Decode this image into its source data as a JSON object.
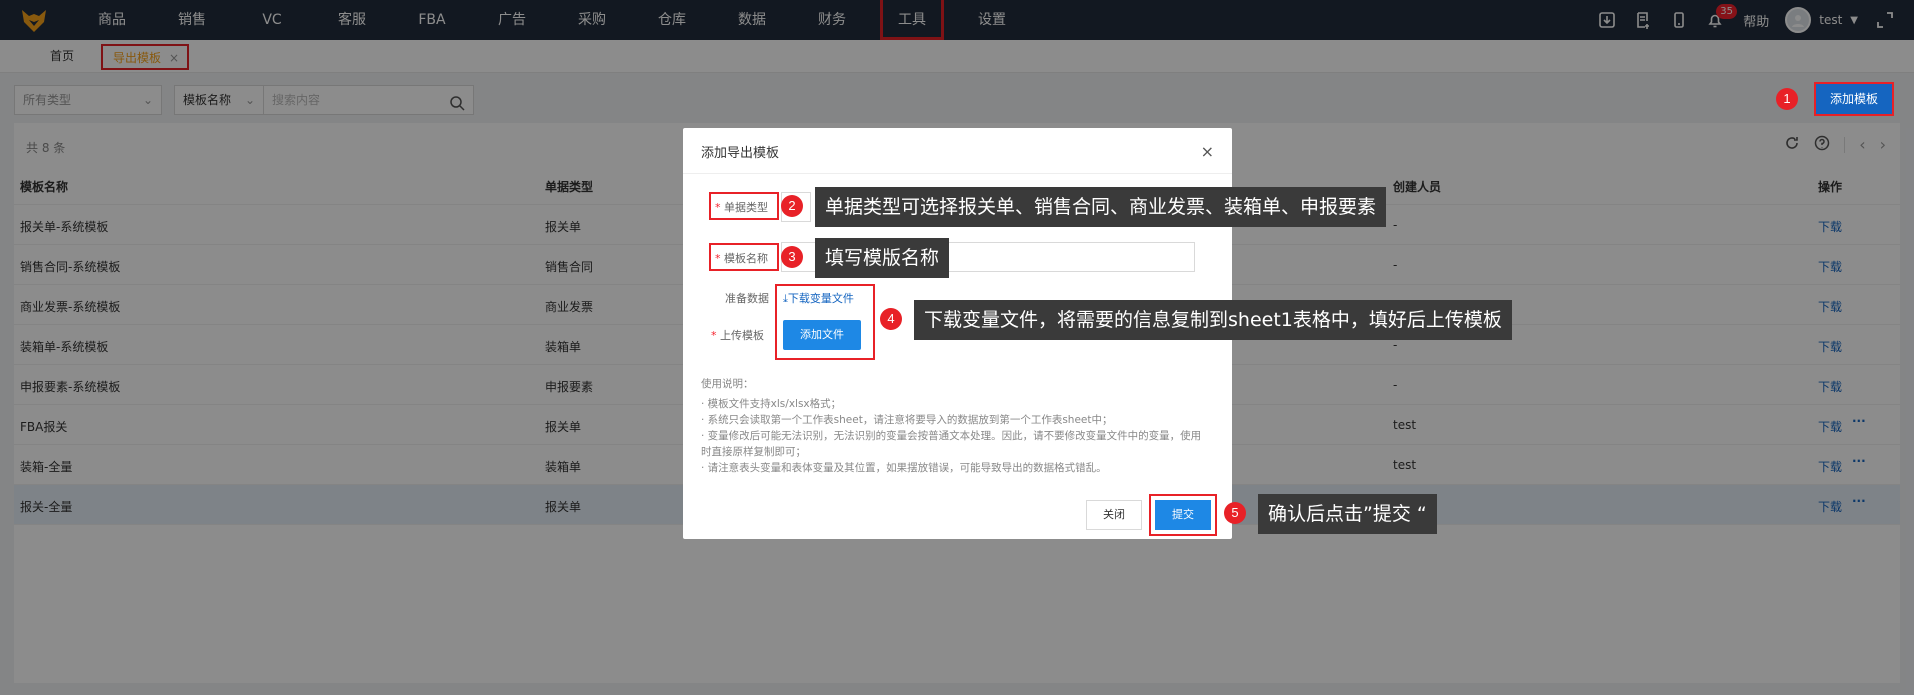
{
  "nav": {
    "items": [
      "商品",
      "销售",
      "VC",
      "客服",
      "FBA",
      "广告",
      "采购",
      "仓库",
      "数据",
      "财务",
      "工具",
      "设置"
    ],
    "active_index": 10
  },
  "top_right": {
    "notification_count": "35",
    "help": "帮助",
    "user": "test"
  },
  "tabs": {
    "home": "首页",
    "current": "导出模板",
    "close": "×"
  },
  "filters": {
    "type_placeholder": "所有类型",
    "field_select": "模板名称",
    "search_placeholder": "搜索内容"
  },
  "add_button": "添加模板",
  "table": {
    "count": "共 8 条",
    "headers": [
      "模板名称",
      "单据类型",
      "创建人员",
      "操作"
    ],
    "rows": [
      {
        "name": "报关单-系统模板",
        "type": "报关单",
        "creator": "-",
        "action": "下载",
        "more": ""
      },
      {
        "name": "销售合同-系统模板",
        "type": "销售合同",
        "creator": "-",
        "action": "下载",
        "more": ""
      },
      {
        "name": "商业发票-系统模板",
        "type": "商业发票",
        "creator": "-",
        "action": "下载",
        "more": ""
      },
      {
        "name": "装箱单-系统模板",
        "type": "装箱单",
        "creator": "-",
        "action": "下载",
        "more": ""
      },
      {
        "name": "申报要素-系统模板",
        "type": "申报要素",
        "creator": "-",
        "action": "下载",
        "more": ""
      },
      {
        "name": "FBA报关",
        "type": "报关单",
        "creator": "test",
        "action": "下载",
        "more": "···"
      },
      {
        "name": "装箱-全量",
        "type": "装箱单",
        "creator": "test",
        "action": "下载",
        "more": "···"
      },
      {
        "name": "报关-全量",
        "type": "报关单",
        "creator": "",
        "action": "下载",
        "more": "···"
      }
    ]
  },
  "dialog": {
    "title": "添加导出模板",
    "close": "×",
    "doc_type_label": "单据类型",
    "template_name_label": "模板名称",
    "prepare_label": "准备数据",
    "download_link": "下载变量文件",
    "upload_label": "上传模板",
    "upload_button": "添加文件",
    "notes_title": "使用说明：",
    "notes": [
      "· 模板文件支持xls/xlsx格式；",
      "· 系统只会读取第一个工作表sheet，请注意将要导入的数据放到第一个工作表sheet中；",
      "· 变量修改后可能无法识别，无法识别的变量会按普通文本处理。因此，请不要修改变量文件中的变量，使用时直接原样复制即可；",
      "· 请注意表头变量和表体变量及其位置，如果摆放错误，可能导致导出的数据格式错乱。"
    ],
    "cancel_button": "关闭",
    "submit_button": "提交"
  },
  "annotations": [
    {
      "num": "1",
      "text": ""
    },
    {
      "num": "2",
      "text": "单据类型可选择报关单、销售合同、商业发票、装箱单、申报要素"
    },
    {
      "num": "3",
      "text": "填写模版名称"
    },
    {
      "num": "4",
      "text": "下载变量文件，将需要的信息复制到sheet1表格中，填好后上传模板"
    },
    {
      "num": "5",
      "text": "确认后点击”提交 “"
    }
  ],
  "colors": {
    "topbar": "#222d3c",
    "primary": "#1e88e5",
    "highlight": "#e82127",
    "tab_active": "#f7a21b"
  }
}
